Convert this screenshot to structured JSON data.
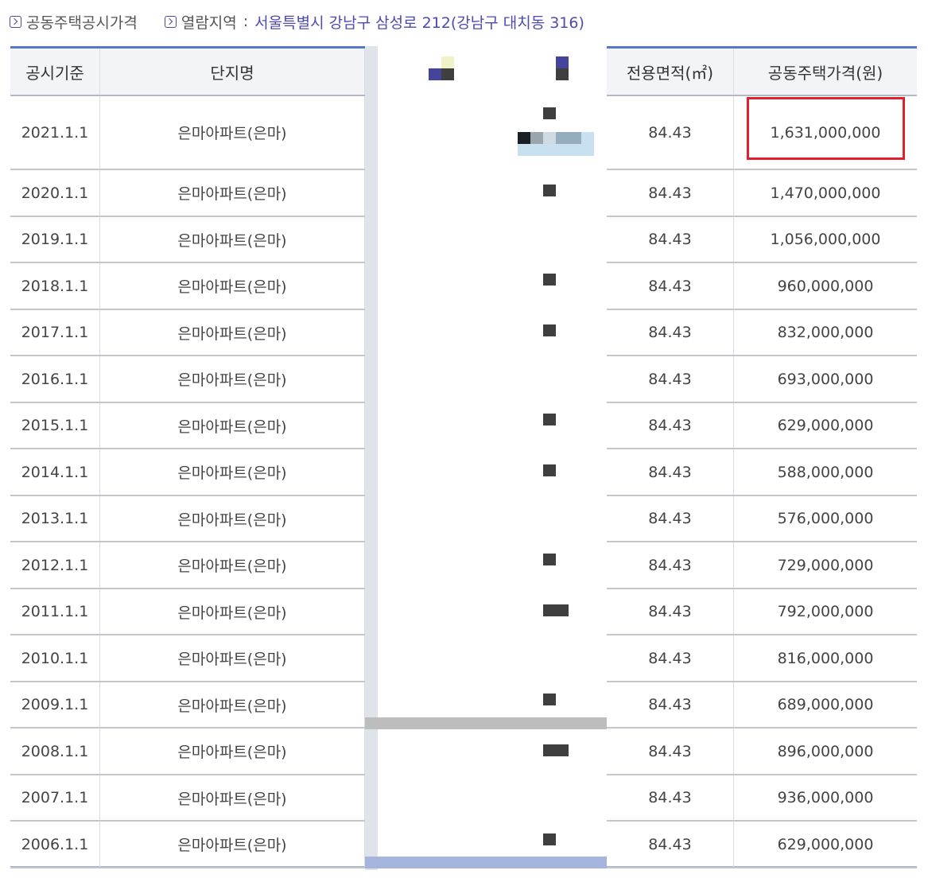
{
  "breadcrumb": {
    "item1": "공동주택공시가격",
    "item2_label": "열람지역",
    "item2_sep": ":",
    "item2_value": "서울특별시 강남구 삼성로 212(강남구 대치동 316)"
  },
  "table": {
    "headers": {
      "date": "공시기준",
      "name": "단지명",
      "area": "전용면적(㎡)",
      "price": "공동주택가격(원)"
    },
    "rows": [
      {
        "date": "2021.1.1",
        "name": "은마아파트(은마)",
        "area": "84.43",
        "price": "1,631,000,000"
      },
      {
        "date": "2020.1.1",
        "name": "은마아파트(은마)",
        "area": "84.43",
        "price": "1,470,000,000"
      },
      {
        "date": "2019.1.1",
        "name": "은마아파트(은마)",
        "area": "84.43",
        "price": "1,056,000,000"
      },
      {
        "date": "2018.1.1",
        "name": "은마아파트(은마)",
        "area": "84.43",
        "price": "960,000,000"
      },
      {
        "date": "2017.1.1",
        "name": "은마아파트(은마)",
        "area": "84.43",
        "price": "832,000,000"
      },
      {
        "date": "2016.1.1",
        "name": "은마아파트(은마)",
        "area": "84.43",
        "price": "693,000,000"
      },
      {
        "date": "2015.1.1",
        "name": "은마아파트(은마)",
        "area": "84.43",
        "price": "629,000,000"
      },
      {
        "date": "2014.1.1",
        "name": "은마아파트(은마)",
        "area": "84.43",
        "price": "588,000,000"
      },
      {
        "date": "2013.1.1",
        "name": "은마아파트(은마)",
        "area": "84.43",
        "price": "576,000,000"
      },
      {
        "date": "2012.1.1",
        "name": "은마아파트(은마)",
        "area": "84.43",
        "price": "729,000,000"
      },
      {
        "date": "2011.1.1",
        "name": "은마아파트(은마)",
        "area": "84.43",
        "price": "792,000,000"
      },
      {
        "date": "2010.1.1",
        "name": "은마아파트(은마)",
        "area": "84.43",
        "price": "816,000,000"
      },
      {
        "date": "2009.1.1",
        "name": "은마아파트(은마)",
        "area": "84.43",
        "price": "689,000,000"
      },
      {
        "date": "2008.1.1",
        "name": "은마아파트(은마)",
        "area": "84.43",
        "price": "896,000,000"
      },
      {
        "date": "2007.1.1",
        "name": "은마아파트(은마)",
        "area": "84.43",
        "price": "936,000,000"
      },
      {
        "date": "2006.1.1",
        "name": "은마아파트(은마)",
        "area": "84.43",
        "price": "629,000,000"
      }
    ]
  },
  "colors": {
    "accent": "#4b4bb0",
    "header_bg": "#f3f4f8",
    "highlight_box": "#e0202a"
  }
}
